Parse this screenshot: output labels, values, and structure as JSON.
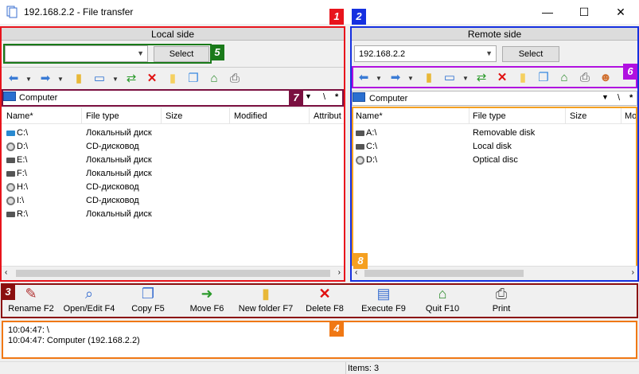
{
  "window": {
    "title": "192.168.2.2 - File transfer",
    "minimize": "—",
    "maximize": "☐",
    "close": "✕"
  },
  "local": {
    "header": "Local side",
    "host_value": "",
    "select_label": "Select",
    "path": "Computer",
    "columns": [
      "Name*",
      "File type",
      "Size",
      "Modified",
      "Attribut"
    ],
    "rows": [
      {
        "name": "C:\\",
        "type": "Локальный диск",
        "icon": "os-drive-icon"
      },
      {
        "name": "D:\\",
        "type": "CD-дисковод",
        "icon": "cd-drive-icon"
      },
      {
        "name": "E:\\",
        "type": "Локальный диск",
        "icon": "drive-icon"
      },
      {
        "name": "F:\\",
        "type": "Локальный диск",
        "icon": "drive-icon"
      },
      {
        "name": "H:\\",
        "type": "CD-дисковод",
        "icon": "cd-drive-icon"
      },
      {
        "name": "I:\\",
        "type": "CD-дисковод",
        "icon": "cd-drive-icon"
      },
      {
        "name": "R:\\",
        "type": "Локальный диск",
        "icon": "drive-icon"
      }
    ],
    "path_sep": "\\",
    "path_star": "*"
  },
  "remote": {
    "header": "Remote side",
    "host_value": "192.168.2.2",
    "select_label": "Select",
    "path": "Computer",
    "columns": [
      "Name*",
      "File type",
      "Size",
      "Mo"
    ],
    "rows": [
      {
        "name": "A:\\",
        "type": "Removable disk",
        "icon": "floppy-drive-icon"
      },
      {
        "name": "C:\\",
        "type": "Local disk",
        "icon": "drive-icon"
      },
      {
        "name": "D:\\",
        "type": "Optical disc",
        "icon": "cd-drive-icon"
      }
    ],
    "path_sep": "\\",
    "path_star": "*"
  },
  "badges": [
    "1",
    "2",
    "3",
    "4",
    "5",
    "6",
    "7",
    "8"
  ],
  "badge_colors": {
    "red": "#e8141c",
    "blue": "#1530e0",
    "maroon": "#8b0f0f",
    "orange": "#f07814",
    "green": "#1a7a1a",
    "purple": "#b010e0",
    "dark_red": "#7a1040",
    "amber": "#f5a020"
  },
  "toolbar_icons": [
    "back-arrow-icon",
    "forward-arrow-icon",
    "up-folder-icon",
    "computer-icon",
    "refresh-icon",
    "delete-x-icon",
    "new-folder-icon",
    "copy-icon",
    "home-icon",
    "print-icon",
    "user-icon"
  ],
  "actions": [
    {
      "label": "Rename F2",
      "icon": "pencil-icon"
    },
    {
      "label": "Open/Edit F4",
      "icon": "magnifier-doc-icon"
    },
    {
      "label": "Copy F5",
      "icon": "copy-doc-icon"
    },
    {
      "label": "Move F6",
      "icon": "move-folder-icon"
    },
    {
      "label": "New folder F7",
      "icon": "folder-icon"
    },
    {
      "label": "Delete F8",
      "icon": "delete-x-icon"
    },
    {
      "label": "Execute F9",
      "icon": "execute-icon"
    },
    {
      "label": "Quit F10",
      "icon": "quit-house-icon"
    },
    {
      "label": "Print",
      "icon": "printer-icon"
    }
  ],
  "log": [
    "10:04:47: \\",
    "10:04:47: Computer   (192.168.2.2)"
  ],
  "status": {
    "items": "Items: 3"
  }
}
